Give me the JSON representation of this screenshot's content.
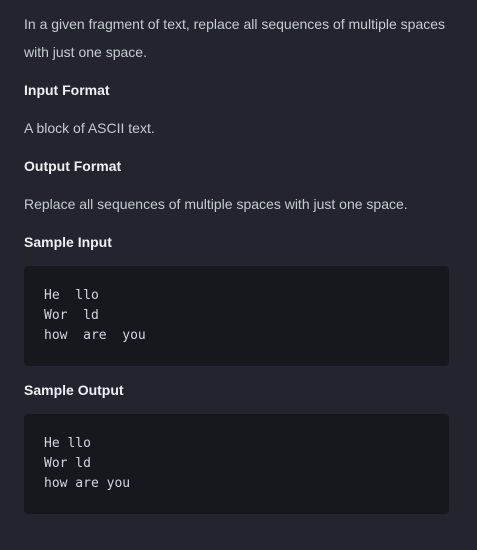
{
  "problem": {
    "description": "In a given fragment of text, replace all sequences of multiple spaces with just one space.",
    "input_format_heading": "Input Format",
    "input_format_text": "A block of ASCII text.",
    "output_format_heading": "Output Format",
    "output_format_text": "Replace all sequences of multiple spaces with just one space.",
    "sample_input_heading": "Sample Input",
    "sample_input_lines": [
      "He  llo",
      "Wor  ld",
      "how  are  you"
    ],
    "sample_output_heading": "Sample Output",
    "sample_output_lines": [
      "He llo",
      "Wor ld",
      "how are you"
    ]
  }
}
